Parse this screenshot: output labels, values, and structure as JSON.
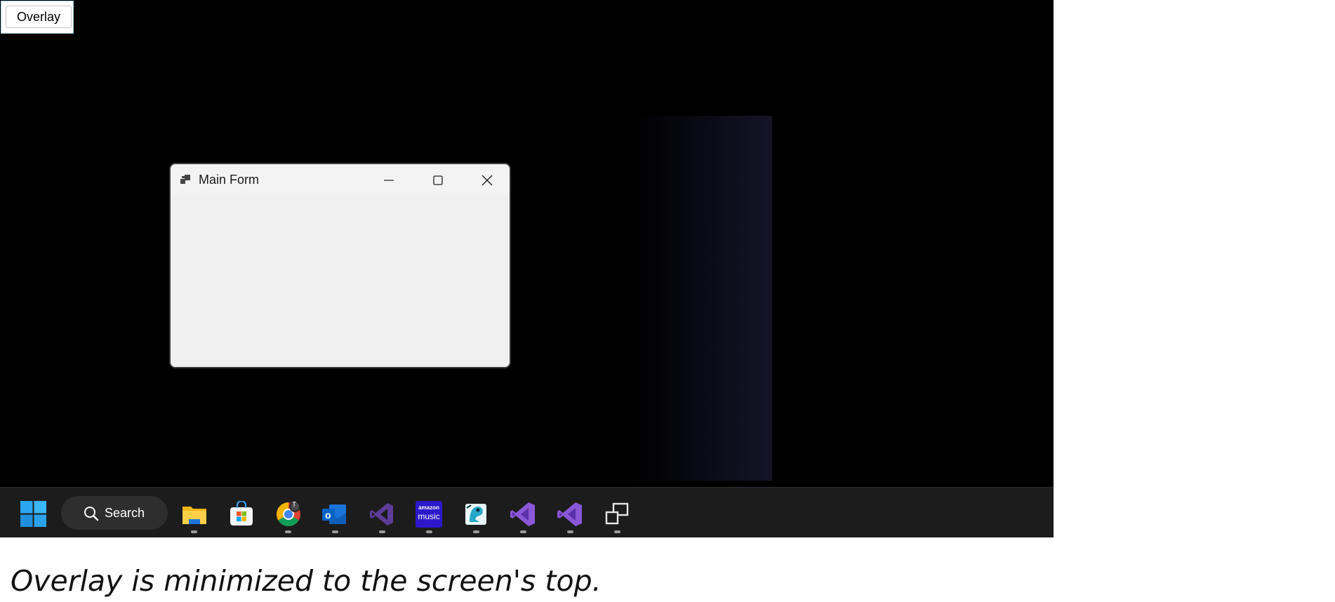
{
  "overlay": {
    "button_label": "Overlay"
  },
  "main_window": {
    "title": "Main Form",
    "controls": {
      "minimize": "minimize",
      "maximize": "maximize",
      "close": "close"
    }
  },
  "taskbar": {
    "search_label": "Search",
    "apps": [
      {
        "name": "File Explorer",
        "icon": "file-explorer-icon"
      },
      {
        "name": "Microsoft Store",
        "icon": "microsoft-store-icon"
      },
      {
        "name": "Google Chrome",
        "icon": "chrome-icon",
        "badge": "T"
      },
      {
        "name": "Outlook",
        "icon": "outlook-icon",
        "letter": "o"
      },
      {
        "name": "Visual Studio Code",
        "icon": "vscode-icon"
      },
      {
        "name": "Amazon Music",
        "icon": "amazon-music-icon",
        "text_top": "amazon",
        "text_bottom": "music"
      },
      {
        "name": "Character Map",
        "icon": "app-icon"
      },
      {
        "name": "Visual Studio",
        "icon": "visual-studio-icon"
      },
      {
        "name": "Visual Studio",
        "icon": "visual-studio-icon"
      },
      {
        "name": "Windows",
        "icon": "windows-forms-icon"
      }
    ]
  },
  "colors": {
    "taskbar_bg": "#1c1c1c",
    "desktop_bg": "#000000",
    "window_bg": "#f0f0f0",
    "vs_purple": "#7b4cc4"
  },
  "caption": "Overlay is minimized to the screen's top."
}
